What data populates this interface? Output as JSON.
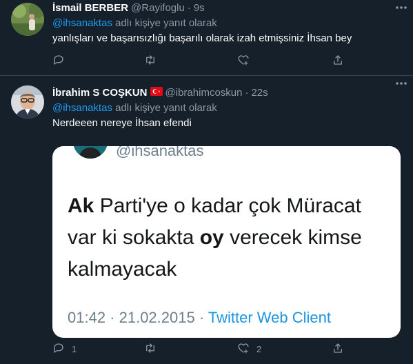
{
  "tweets": [
    {
      "display_name": "İsmail BERBER",
      "handle": "@Rayifoglu",
      "separator": "·",
      "time": "9s",
      "reply_to": {
        "mention": "@ihsanaktas",
        "suffix": "adlı kişiye yanıt olarak"
      },
      "text": "yanlışları ve başarısızlığı başarılı olarak izah etmişsiniz İhsan bey",
      "actions": {
        "reply_count": "",
        "retweet_count": "",
        "like_count": ""
      }
    },
    {
      "display_name": "İbrahim S COŞKUN",
      "flag": "turkey-flag",
      "handle": "@ibrahimcoskun",
      "separator": "·",
      "time": "22s",
      "reply_to": {
        "mention": "@ihsanaktas",
        "suffix": "adlı kişiye yanıt olarak"
      },
      "text": "Nerdeeen nereye İhsan efendi",
      "image_card": {
        "handle": "@ihsanaktas",
        "text_parts": [
          "Ak",
          " Parti'ye o kadar çok Müracat var ki sokakta ",
          "oy",
          " verecek kimse kalmayacak"
        ],
        "timestamp": "01:42 · 21.02.2015 · ",
        "client": "Twitter Web Client"
      },
      "actions": {
        "reply_count": "1",
        "retweet_count": "",
        "like_count": "2"
      }
    }
  ],
  "colors": {
    "background": "#15202b",
    "text": "#ffffff",
    "muted": "#8b98a5",
    "accent": "#1d9bf0",
    "divider": "#38444d"
  }
}
